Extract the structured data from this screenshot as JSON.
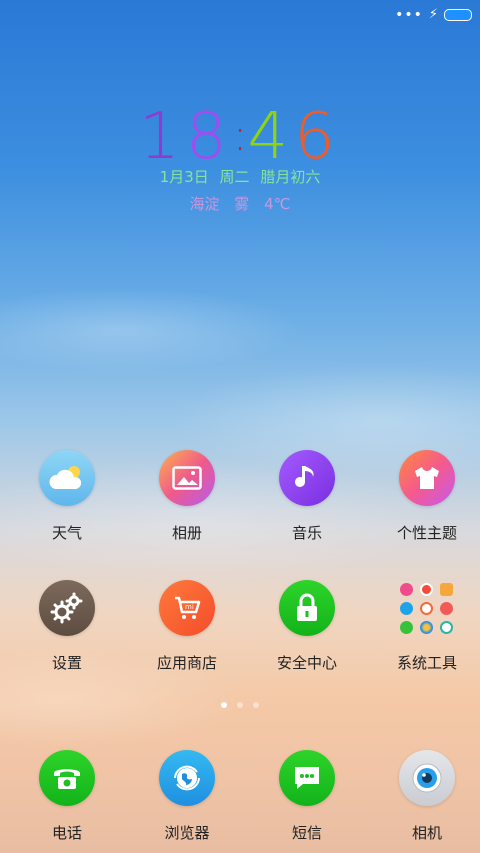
{
  "status_bar": {
    "signal": "•••",
    "charging": "⚡"
  },
  "clock": {
    "d1": "1",
    "d2": "8",
    "colon": ":",
    "d3": "4",
    "d4": "6",
    "colors": [
      "#8e3bd1",
      "#a24cf0",
      "#d6161b",
      "#8fd40c",
      "#ef5b2a"
    ]
  },
  "date": {
    "md": "1月3日",
    "weekday": "周二",
    "lunar": "腊月初六"
  },
  "weather": {
    "location": "海淀",
    "condition": "雾",
    "temp": "4℃"
  },
  "apps_row1": [
    {
      "label": "天气",
      "icon": "weather-icon"
    },
    {
      "label": "相册",
      "icon": "gallery-icon"
    },
    {
      "label": "音乐",
      "icon": "music-icon"
    },
    {
      "label": "个性主题",
      "icon": "theme-icon"
    }
  ],
  "apps_row2": [
    {
      "label": "设置",
      "icon": "settings-icon"
    },
    {
      "label": "应用商店",
      "icon": "app-store-icon"
    },
    {
      "label": "安全中心",
      "icon": "security-icon"
    },
    {
      "label": "系统工具",
      "icon": "tools-folder-icon"
    }
  ],
  "dock": [
    {
      "label": "电话",
      "icon": "phone-icon"
    },
    {
      "label": "浏览器",
      "icon": "browser-icon"
    },
    {
      "label": "短信",
      "icon": "sms-icon"
    },
    {
      "label": "相机",
      "icon": "camera-icon"
    }
  ],
  "pager": {
    "pages": 3,
    "active": 1
  }
}
